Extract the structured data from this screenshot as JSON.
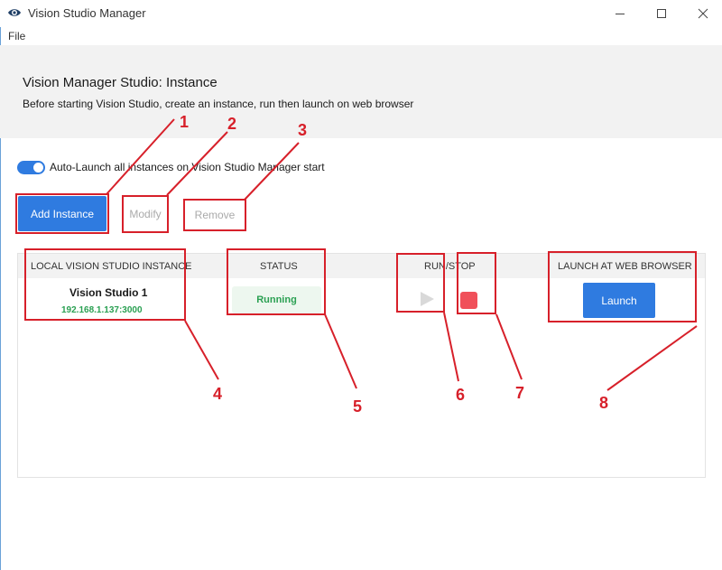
{
  "window": {
    "title": "Vision Studio Manager"
  },
  "menu": {
    "file": "File"
  },
  "header": {
    "title": "Vision Manager Studio: Instance",
    "subtitle": "Before starting Vision Studio, create an instance, run then launch on web browser"
  },
  "auto_launch": {
    "label": "Auto-Launch all instances on Vision Studio Manager start",
    "enabled": true
  },
  "toolbar": {
    "add_label": "Add Instance",
    "modify_label": "Modify",
    "remove_label": "Remove"
  },
  "table": {
    "columns": [
      "LOCAL VISION STUDIO INSTANCE",
      "STATUS",
      "RUN/STOP",
      "LAUNCH AT WEB BROWSER"
    ],
    "rows": [
      {
        "name": "Vision Studio 1",
        "address": "192.168.1.137:3000",
        "status": "Running",
        "launch_label": "Launch"
      }
    ]
  },
  "annotations": [
    "1",
    "2",
    "3",
    "4",
    "5",
    "6",
    "7",
    "8"
  ],
  "colors": {
    "accent": "#2f7be0",
    "running": "#2aa052",
    "stop": "#f0505a",
    "annotation": "#d7202a",
    "header_bg": "#f2f2f2"
  },
  "icons": {
    "app": "eye-logo-icon",
    "minimize": "minimize-icon",
    "maximize": "maximize-icon",
    "close": "close-icon",
    "play": "play-icon",
    "stop": "stop-icon"
  }
}
